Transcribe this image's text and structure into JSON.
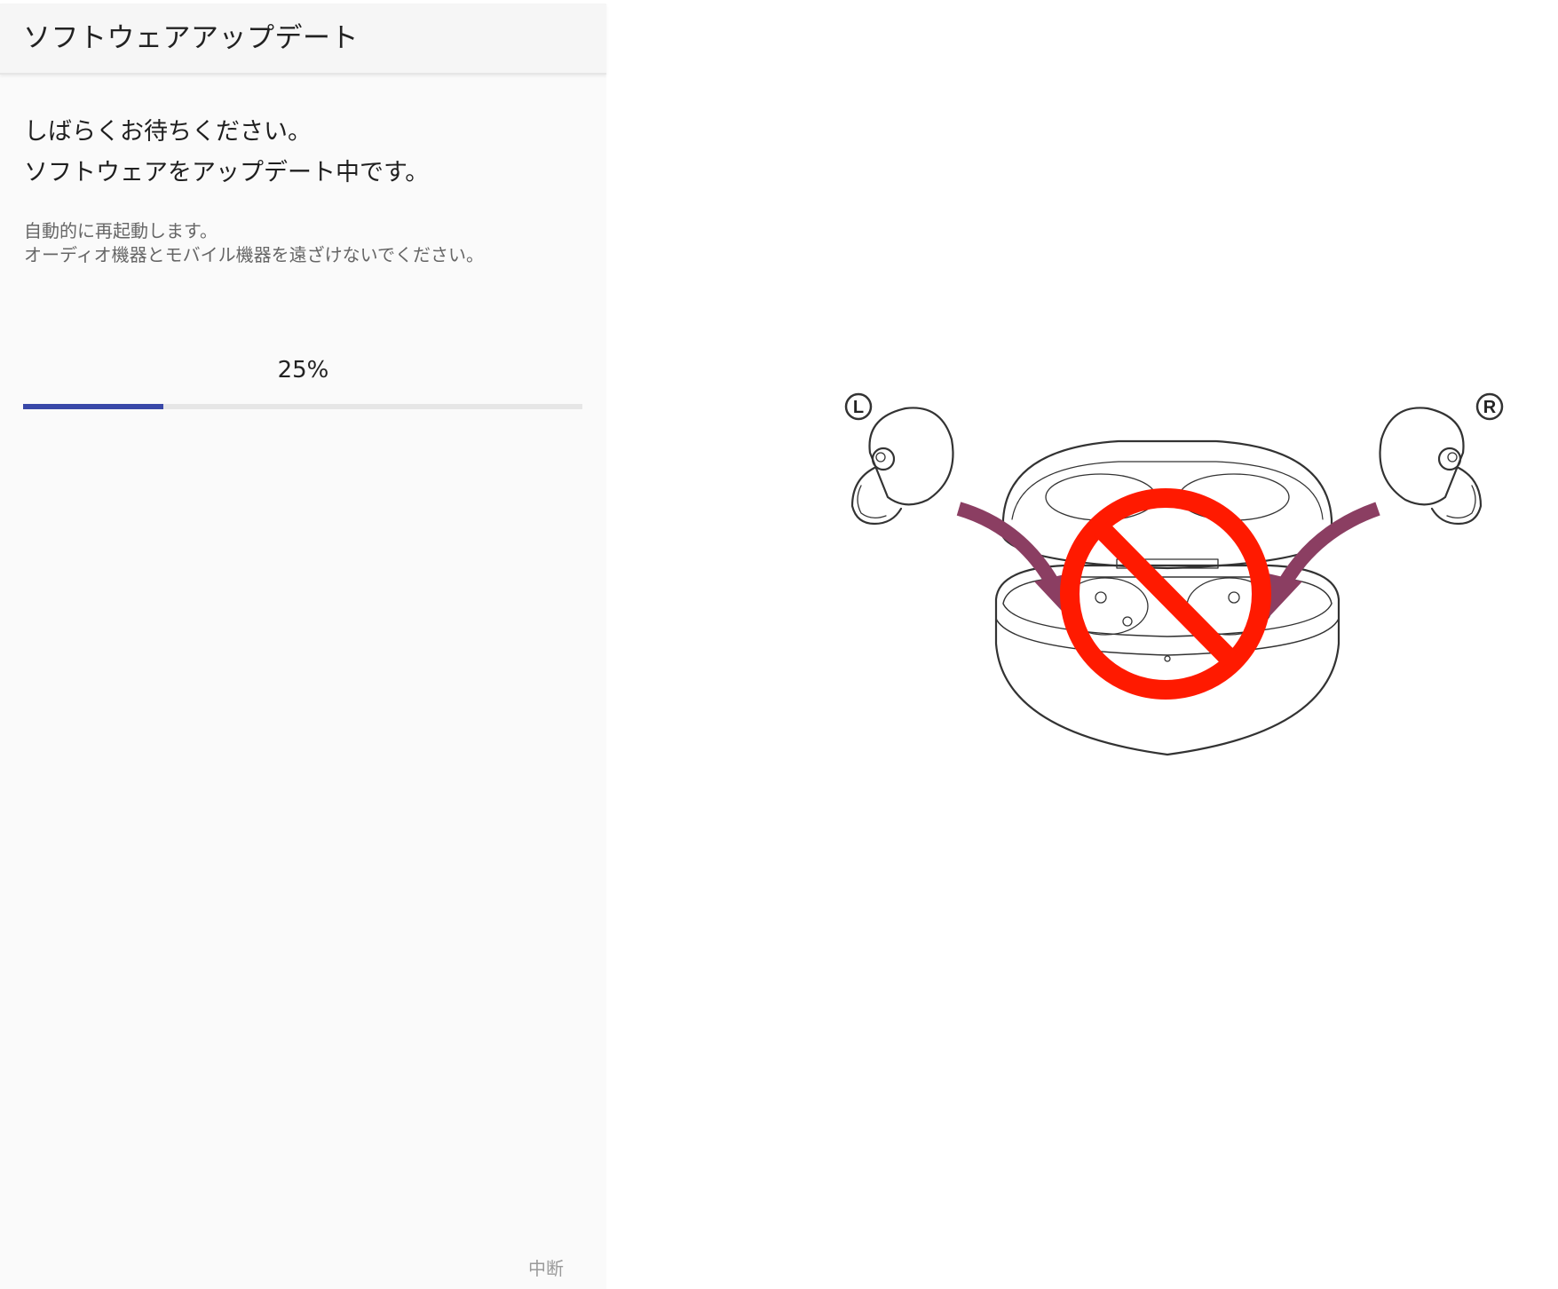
{
  "header": {
    "title": "ソフトウェアアップデート"
  },
  "message": {
    "line1": "しばらくお待ちください。",
    "line2": "ソフトウェアをアップデート中です。"
  },
  "notice": {
    "line1": "自動的に再起動します。",
    "line2": "オーディオ機器とモバイル機器を遠ざけないでください。"
  },
  "progress": {
    "label": "25%",
    "value": 0.25,
    "color": "#3948a8"
  },
  "footer": {
    "cancel_label": "中断"
  },
  "illustration": {
    "left_label": "L",
    "right_label": "R",
    "icon": "no-earbuds-in-case-prohibition",
    "arrow_color": "#8b3e62",
    "prohibit_color": "#ff1a00"
  }
}
